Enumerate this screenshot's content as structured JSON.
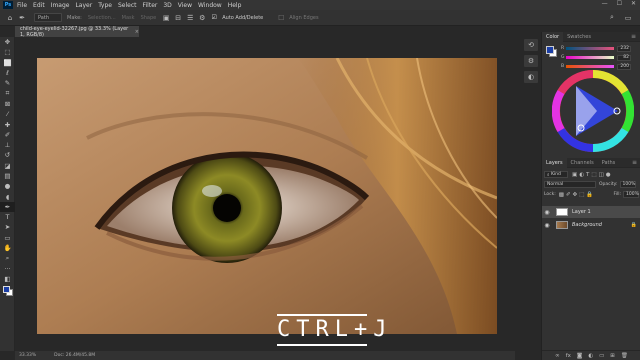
{
  "menu": {
    "items": [
      "File",
      "Edit",
      "Image",
      "Layer",
      "Type",
      "Select",
      "Filter",
      "3D",
      "View",
      "Window",
      "Help"
    ],
    "window_buttons": [
      "—",
      "☐",
      "✕"
    ]
  },
  "options": {
    "path_mode": "Path",
    "make_label": "Make:",
    "buttons": [
      "Selection...",
      "Mask",
      "Shape"
    ],
    "auto_add_delete": "Auto Add/Delete",
    "align_edges": "Align Edges"
  },
  "document": {
    "tab_title": "child-eye-eyelid-32267.jpg @ 33.3% (Layer 1, RGB/8)",
    "close": "×"
  },
  "overlay_text": "CTRL+J",
  "status": {
    "zoom": "33.33%",
    "doc_size": "Doc: 26.4M/45.8M"
  },
  "color_panel": {
    "tabs": [
      "Color",
      "Swatches"
    ],
    "sliders": [
      {
        "label": "R",
        "value": "232"
      },
      {
        "label": "G",
        "value": "82"
      },
      {
        "label": "B",
        "value": "200"
      }
    ],
    "foreground_color": "#1c3fa6",
    "background_color": "#ffffff"
  },
  "layers_panel": {
    "tabs": [
      "Layers",
      "Channels",
      "Paths"
    ],
    "kind_placeholder": "Kind",
    "blend_mode": "Normal",
    "opacity_label": "Opacity:",
    "opacity_value": "100%",
    "lock_label": "Lock:",
    "fill_label": "Fill:",
    "fill_value": "100%",
    "layers": [
      {
        "name": "Layer 1",
        "selected": true
      },
      {
        "name": "Background",
        "selected": false
      }
    ]
  },
  "icons": {
    "toolbar": [
      "move-icon",
      "artboard-icon",
      "marquee-icon",
      "lasso-icon",
      "quick-select-icon",
      "crop-icon",
      "frame-icon",
      "eyedropper-icon",
      "healing-brush-icon",
      "brush-icon",
      "clone-stamp-icon",
      "history-brush-icon",
      "eraser-icon",
      "gradient-icon",
      "blur-icon",
      "dodge-icon",
      "pen-icon",
      "type-icon",
      "path-select-icon",
      "rectangle-icon",
      "hand-icon",
      "zoom-icon",
      "more-tools-icon"
    ]
  }
}
